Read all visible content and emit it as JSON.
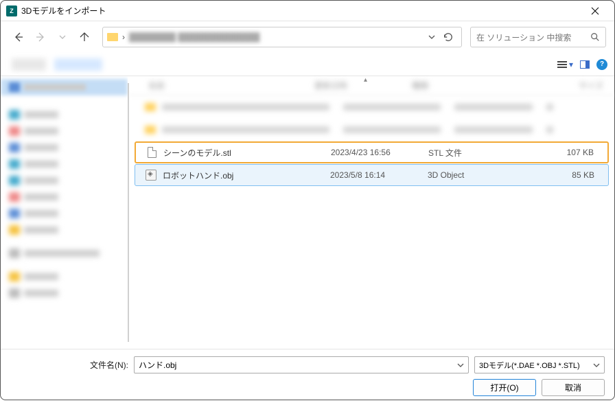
{
  "window": {
    "title": "3Dモデルをインポート",
    "app_icon_letter": "Z"
  },
  "toolbar": {
    "search_placeholder": "在 ソリューション 中搜索",
    "address_sep": "›"
  },
  "columns": {
    "name": "名前",
    "date": "更新日時",
    "type": "種類",
    "size": "サイズ"
  },
  "files": [
    {
      "name": "シーンのモデル.stl",
      "date": "2023/4/23 16:56",
      "type": "STL 文件",
      "size": "107 KB",
      "icon": "doc"
    },
    {
      "name": "ロボットハンド.obj",
      "date": "2023/5/8 16:14",
      "type": "3D Object",
      "size": "85 KB",
      "icon": "obj"
    }
  ],
  "bottom": {
    "filename_label": "文件名(N):",
    "filename_value": "ハンド.obj",
    "filter": "3Dモデル(*.DAE *.OBJ *.STL)",
    "open": "打开(O)",
    "cancel": "取消"
  }
}
